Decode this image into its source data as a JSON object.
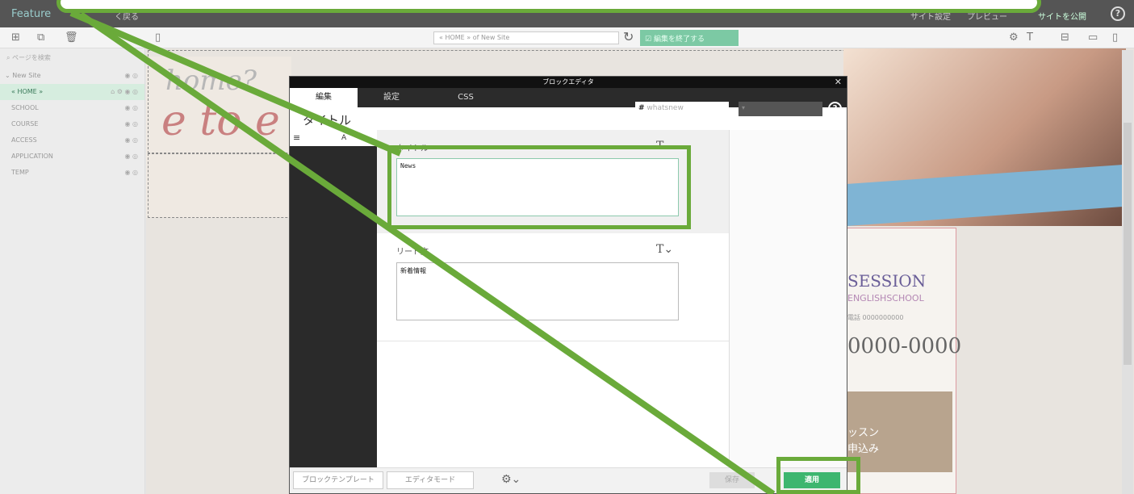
{
  "app": {
    "logo": "Feature",
    "back_label": "く戻る",
    "settings_label": "サイト設定",
    "preview_label": "プレビュー",
    "publish_label": "サイトを公開",
    "help_icon": "question-icon"
  },
  "toolbar": {
    "url": "« HOME » of New Site",
    "finish_label": "編集を終了する"
  },
  "sidebar": {
    "search_placeholder": "ページを検索",
    "root": "New Site",
    "items": [
      {
        "label": "« HOME »"
      },
      {
        "label": "SCHOOL"
      },
      {
        "label": "COURSE"
      },
      {
        "label": "ACCESS"
      },
      {
        "label": "APPLICATION"
      },
      {
        "label": "TEMP"
      }
    ]
  },
  "preview": {
    "brand": "SESSION",
    "brand_sub": "ENGLISHSCHOOL",
    "tel_label": "電話 0000000000",
    "phone": "0000-0000",
    "lesson_line1": "ッスン",
    "lesson_line2": "申込み"
  },
  "modal": {
    "title": "ブロックエディタ",
    "tabs": [
      "編集",
      "設定",
      "CSS"
    ],
    "anchor_prefix": "#",
    "anchor_value": "whatsnew",
    "block_title": "タイトル",
    "list_item": "A",
    "field1_label": "タイトル",
    "field1_value": "News",
    "field2_label": "リード文",
    "field2_value": "新着情報",
    "footer": {
      "template_label": "ブロックテンプレート",
      "mode_label": "エディタモード",
      "save_label": "保存",
      "apply_label": "適用"
    }
  },
  "colors": {
    "annotation": "#6aaa3a",
    "apply": "#3db66f",
    "finish": "#7cc9a4"
  }
}
